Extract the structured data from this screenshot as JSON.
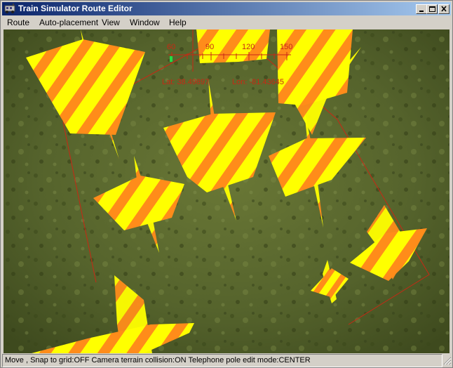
{
  "window": {
    "title": "Train Simulator Route Editor"
  },
  "menu": {
    "route": "Route",
    "auto_placement": "Auto-placement",
    "view": "View",
    "window": "Window",
    "help": "Help"
  },
  "compass": {
    "ticks": [
      "60",
      "90",
      "120",
      "150"
    ],
    "lat_text": "Lat: 38.49897",
    "lon_text": "Lon: -81.43645"
  },
  "status": {
    "text": "Move , Snap to grid:OFF Camera terrain collision:ON Telephone pole edit mode:CENTER"
  },
  "colors": {
    "title_start": "#0a246a",
    "title_end": "#a6caf0",
    "stripe_yellow": "#ffff00",
    "stripe_orange": "#ff8c1a",
    "overlay_red": "#c82814",
    "grass": "#4e5c28"
  },
  "icons": {
    "app": "train-icon",
    "minimize": "minimize-icon",
    "maximize": "maximize-icon",
    "close": "close-icon",
    "resize": "resize-grip-icon"
  }
}
